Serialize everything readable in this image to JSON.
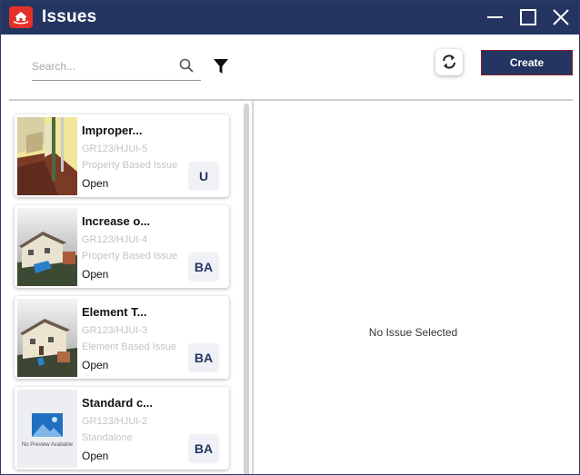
{
  "window": {
    "title": "Issues",
    "accent": "#243561",
    "logo_color": "#e5302a"
  },
  "toolbar": {
    "search_placeholder": "Search...",
    "search_icon": "search-icon",
    "filter_icon": "filter-icon",
    "refresh_icon": "refresh-icon",
    "create_label": "Create"
  },
  "issues": [
    {
      "title": "Improper...",
      "ref": "GR123/HJUI-5",
      "type": "Property Based Issue",
      "status": "Open",
      "badge": "U",
      "thumbnail": "interior-render"
    },
    {
      "title": "Increase o...",
      "ref": "GR123/HJUI-4",
      "type": "Property Based Issue",
      "status": "Open",
      "badge": "BA",
      "thumbnail": "house-render"
    },
    {
      "title": "Element T...",
      "ref": "GR123/HJUI-3",
      "type": "Element Based Issue",
      "status": "Open",
      "badge": "BA",
      "thumbnail": "house-render"
    },
    {
      "title": "Standard c...",
      "ref": "GR123/HJUI-2",
      "type": "Standalone",
      "status": "Open",
      "badge": "BA",
      "thumbnail": "no-preview",
      "thumbnail_text": "No Preview Available"
    }
  ],
  "detail": {
    "empty_text": "No Issue Selected"
  }
}
